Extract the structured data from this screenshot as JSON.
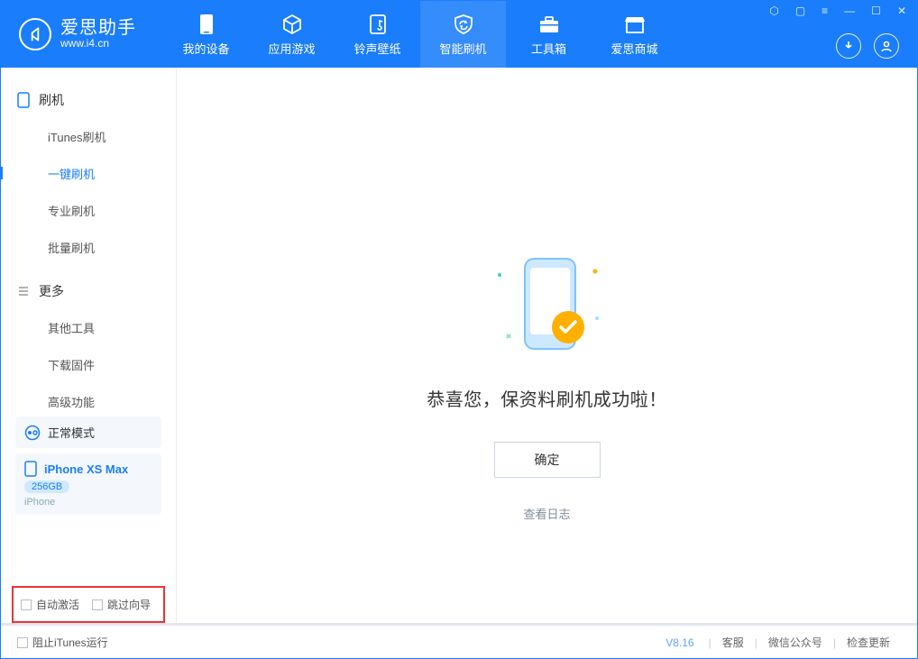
{
  "app": {
    "name": "爱思助手",
    "url": "www.i4.cn"
  },
  "tabs": [
    {
      "label": "我的设备"
    },
    {
      "label": "应用游戏"
    },
    {
      "label": "铃声壁纸"
    },
    {
      "label": "智能刷机"
    },
    {
      "label": "工具箱"
    },
    {
      "label": "爱思商城"
    }
  ],
  "sidebar": {
    "section1": {
      "title": "刷机",
      "items": [
        "iTunes刷机",
        "一键刷机",
        "专业刷机",
        "批量刷机"
      ]
    },
    "section2": {
      "title": "更多",
      "items": [
        "其他工具",
        "下载固件",
        "高级功能"
      ]
    }
  },
  "mode": {
    "normal": "正常模式"
  },
  "device": {
    "name": "iPhone XS Max",
    "storage": "256GB",
    "type": "iPhone"
  },
  "options": {
    "auto_activate": "自动激活",
    "skip_guide": "跳过向导"
  },
  "main": {
    "title": "恭喜您，保资料刷机成功啦！",
    "ok": "确定",
    "view_log": "查看日志"
  },
  "footer": {
    "block_itunes": "阻止iTunes运行",
    "version": "V8.16",
    "links": [
      "客服",
      "微信公众号",
      "检查更新"
    ]
  }
}
